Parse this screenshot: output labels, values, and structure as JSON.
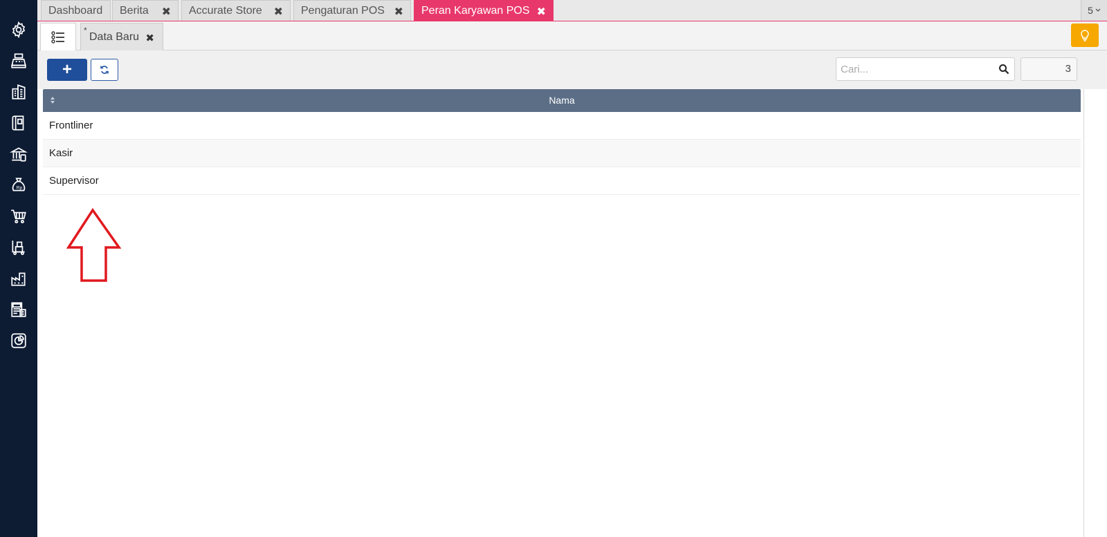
{
  "tabs": [
    {
      "label": "Dashboard",
      "closable": false,
      "active": false
    },
    {
      "label": "Berita",
      "closable": true,
      "active": false
    },
    {
      "label": "Accurate Store",
      "closable": true,
      "active": false
    },
    {
      "label": "Pengaturan POS",
      "closable": true,
      "active": false
    },
    {
      "label": "Peran Karyawan POS",
      "closable": true,
      "active": true
    }
  ],
  "tab_count": "5",
  "subtab": {
    "marker": "*",
    "label": "Data Baru"
  },
  "toolbar": {
    "add_label": "+",
    "search_placeholder": "Cari...",
    "record_count": "3"
  },
  "table": {
    "header": "Nama",
    "rows": [
      "Frontliner",
      "Kasir",
      "Supervisor"
    ]
  },
  "colors": {
    "sidebar": "#0d1b33",
    "active_tab": "#e8386b",
    "primary": "#1f4e9a",
    "header_bg": "#5b6e86",
    "bulb": "#f6a800",
    "annotation_arrow": "#e0191e"
  }
}
